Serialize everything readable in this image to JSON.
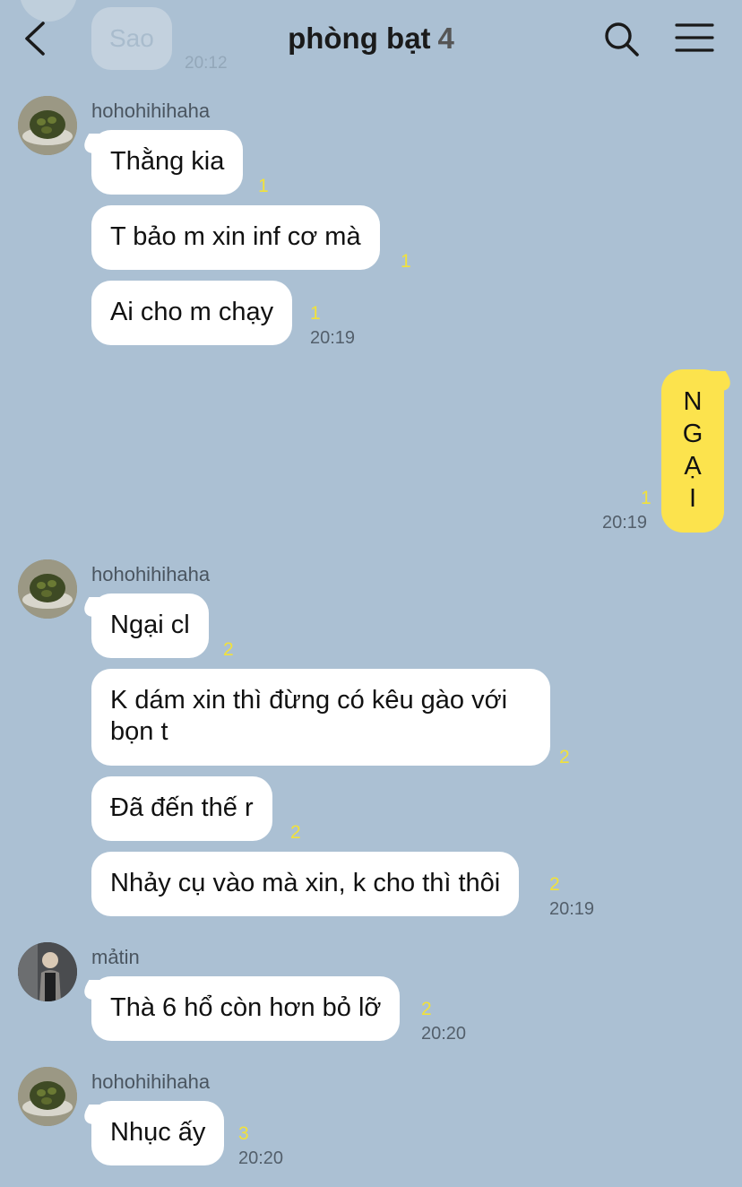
{
  "header": {
    "title": "phòng bạt",
    "member_count": "4",
    "icons": [
      "back-arrow-icon",
      "search-icon",
      "hamburger-menu-icon"
    ]
  },
  "prev_message": {
    "text": "Sao",
    "time": "20:12"
  },
  "groups": [
    {
      "sender": "hohohihihaha",
      "messages": [
        {
          "text": "Thằng kia",
          "unread": "1"
        },
        {
          "text": "T bảo m xin inf cơ mà",
          "unread": "1"
        },
        {
          "text": "Ai cho m chạy",
          "unread": "1",
          "time": "20:19"
        }
      ]
    },
    {
      "sender": "me",
      "messages": [
        {
          "letters": [
            "N",
            "G",
            "Ạ",
            "I"
          ],
          "unread": "1",
          "time": "20:19"
        }
      ]
    },
    {
      "sender": "hohohihihaha",
      "messages": [
        {
          "text": "Ngại cl",
          "unread": "2"
        },
        {
          "text": "K dám xin thì đừng có kêu gào với bọn t",
          "unread": "2"
        },
        {
          "text": "Đã đến thế r",
          "unread": "2"
        },
        {
          "text": "Nhảy cụ vào mà xin, k cho thì thôi",
          "unread": "2",
          "time": "20:19"
        }
      ]
    },
    {
      "sender": "mảtin",
      "messages": [
        {
          "text": "Thà 6 hổ còn hơn bỏ lỡ",
          "unread": "2",
          "time": "20:20"
        }
      ]
    },
    {
      "sender": "hohohihihaha",
      "messages": [
        {
          "text": "Nhục ấy",
          "unread": "3",
          "time": "20:20"
        }
      ]
    }
  ],
  "colors": {
    "background": "#abc0d3",
    "bubble_other": "#ffffff",
    "bubble_mine": "#fce34d",
    "unread": "#f1e13b"
  }
}
